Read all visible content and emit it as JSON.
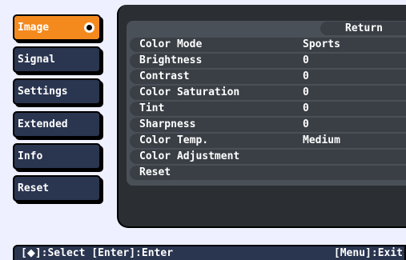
{
  "sidebar": {
    "items": [
      {
        "label": "Image",
        "active": true
      },
      {
        "label": "Signal"
      },
      {
        "label": "Settings"
      },
      {
        "label": "Extended"
      },
      {
        "label": "Info"
      },
      {
        "label": "Reset"
      }
    ]
  },
  "panel": {
    "return_label": "Return",
    "rows": [
      {
        "label": "Color Mode",
        "value": "Sports"
      },
      {
        "label": "Brightness",
        "value": "0"
      },
      {
        "label": "Contrast",
        "value": "0"
      },
      {
        "label": "Color Saturation",
        "value": "0"
      },
      {
        "label": "Tint",
        "value": "0"
      },
      {
        "label": "Sharpness",
        "value": "0"
      },
      {
        "label": "Color Temp.",
        "value": "Medium"
      },
      {
        "label": "Color Adjustment",
        "value": ""
      },
      {
        "label": "Reset",
        "value": ""
      }
    ]
  },
  "footer": {
    "arrow_glyph": "◆",
    "left_prefix": "[",
    "left_text": "]:Select [Enter]:Enter",
    "right_text": "[Menu]:Exit"
  },
  "colors": {
    "active_item": "#f48a1e",
    "item_bg": "#2a3550",
    "panel_bg": "#2b2f33"
  }
}
